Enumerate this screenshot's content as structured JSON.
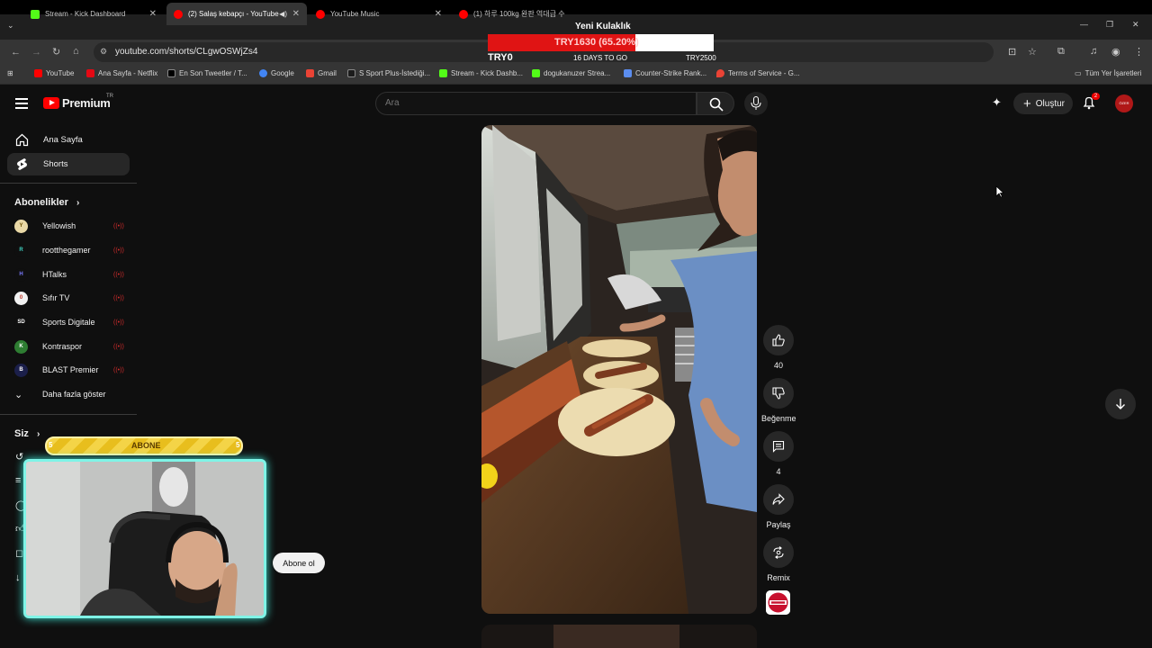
{
  "browser": {
    "tabs": [
      {
        "title": "Stream - Kick Dashboard",
        "favicon_color": "#53fc18"
      },
      {
        "title": "(2) Salaş kebapçı - YouTube",
        "favicon_color": "#ff0000"
      },
      {
        "title": "YouTube Music",
        "favicon_color": "#ff0000"
      },
      {
        "title": "(1) 하루 100kg 완판 역대급 수",
        "favicon_color": "#ff0000"
      }
    ],
    "url": "youtube.com/shorts/CLgwOSWjZs4",
    "bookmarks": [
      {
        "label": "YouTube",
        "color": "#ff0000"
      },
      {
        "label": "Ana Sayfa - Netflix",
        "color": "#e50914"
      },
      {
        "label": "En Son Tweetler / T...",
        "color": "#ffffff"
      },
      {
        "label": "Google",
        "color": "#4285f4"
      },
      {
        "label": "Gmail",
        "color": "#ea4335"
      },
      {
        "label": "S Sport Plus-İstediği...",
        "color": "#1c1c1c"
      },
      {
        "label": "Stream - Kick Dashb...",
        "color": "#53fc18"
      },
      {
        "label": "dogukanuzer Strea...",
        "color": "#53fc18"
      },
      {
        "label": "Counter-Strike Rank...",
        "color": "#5b8def"
      },
      {
        "label": "Terms of Service - G...",
        "color": "#ea4335"
      }
    ],
    "all_bookmarks": "Tüm Yer İşaretleri"
  },
  "stream_overlay": {
    "title": "Yeni Kulaklık",
    "progress_text": "TRY1630 (65.20%)",
    "progress_fraction": 0.652,
    "left_label": "TRY0",
    "mid_label": "16 DAYS TO GO",
    "right_label": "TRY2500",
    "abone_label": "ABONE",
    "abone_left": "5",
    "abone_right": "5"
  },
  "header": {
    "logo_text": "Premium",
    "logo_superscript": "TR",
    "search_placeholder": "Ara",
    "create_label": "Oluştur",
    "notification_count": "2",
    "avatar_text": "ÖZER"
  },
  "sidebar": {
    "nav": [
      {
        "label": "Ana Sayfa"
      },
      {
        "label": "Shorts"
      }
    ],
    "subscriptions_title": "Abonelikler",
    "subscriptions": [
      {
        "name": "Yellowish",
        "initial": "Y",
        "color": "#e9d8a6",
        "text_color": "#6b4f00"
      },
      {
        "name": "rootthegamer",
        "initial": "R",
        "color": "#0f0f0f",
        "text_color": "#3fd1c1"
      },
      {
        "name": "HTalks",
        "initial": "H",
        "color": "#0f0f0f",
        "text_color": "#7a7aff"
      },
      {
        "name": "Sıfır TV",
        "initial": "0",
        "color": "#f1f1f1",
        "text_color": "#c0392b"
      },
      {
        "name": "Sports Digitale",
        "initial": "SD",
        "color": "#0f0f0f",
        "text_color": "#ffffff"
      },
      {
        "name": "Kontraspor",
        "initial": "K",
        "color": "#2e7d32",
        "text_color": "#ffffff"
      },
      {
        "name": "BLAST Premier",
        "initial": "B",
        "color": "#1b1f4a",
        "text_color": "#ffffff"
      }
    ],
    "live_icon": "live-icon",
    "show_more": "Daha fazla göster",
    "you_title": "Siz"
  },
  "short": {
    "likes": "40",
    "dislike_label": "Beğenme",
    "comments": "4",
    "share_label": "Paylaş",
    "remix_label": "Remix"
  },
  "webcam": {
    "tooltip": "Abone ol"
  }
}
